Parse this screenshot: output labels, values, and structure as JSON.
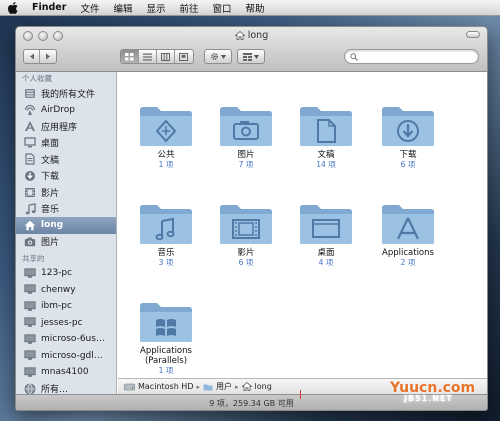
{
  "menubar": {
    "app_name": "Finder",
    "items": [
      "文件",
      "编辑",
      "显示",
      "前往",
      "窗口",
      "帮助"
    ]
  },
  "window": {
    "title": "long",
    "search_placeholder": "",
    "view_modes": [
      "icon",
      "list",
      "column",
      "cover-flow"
    ],
    "active_view": "icon"
  },
  "sidebar": {
    "favorites_heading": "个人收藏",
    "favorites": [
      {
        "label": "我的所有文件",
        "icon": "all-files-icon"
      },
      {
        "label": "AirDrop",
        "icon": "airdrop-icon"
      },
      {
        "label": "应用程序",
        "icon": "applications-icon"
      },
      {
        "label": "桌面",
        "icon": "desktop-icon"
      },
      {
        "label": "文稿",
        "icon": "documents-icon"
      },
      {
        "label": "下载",
        "icon": "downloads-icon"
      },
      {
        "label": "影片",
        "icon": "movies-icon"
      },
      {
        "label": "音乐",
        "icon": "music-icon"
      },
      {
        "label": "long",
        "icon": "home-icon",
        "selected": true
      },
      {
        "label": "图片",
        "icon": "pictures-icon"
      }
    ],
    "shared_heading": "共享的",
    "shared": [
      {
        "label": "123-pc"
      },
      {
        "label": "chenwy"
      },
      {
        "label": "ibm-pc"
      },
      {
        "label": "jesses-pc"
      },
      {
        "label": "microso-6us…"
      },
      {
        "label": "microso-gdl…"
      },
      {
        "label": "mnas4100"
      },
      {
        "label": "所有…"
      }
    ]
  },
  "folders": [
    {
      "name": "公共",
      "count": "1 项",
      "glyph": "public"
    },
    {
      "name": "图片",
      "count": "7 项",
      "glyph": "pictures"
    },
    {
      "name": "文稿",
      "count": "14 项",
      "glyph": "documents"
    },
    {
      "name": "下载",
      "count": "6 项",
      "glyph": "downloads"
    },
    {
      "name": "音乐",
      "count": "3 项",
      "glyph": "music"
    },
    {
      "name": "影片",
      "count": "6 项",
      "glyph": "movies"
    },
    {
      "name": "桌面",
      "count": "4 项",
      "glyph": "desktop"
    },
    {
      "name": "Applications",
      "count": "2 项",
      "glyph": "applications"
    },
    {
      "name": "Applications (Parallels)",
      "count": "1 项",
      "glyph": "windows"
    }
  ],
  "pathbar": [
    "Macintosh HD",
    "用户",
    "long"
  ],
  "status": "9 项，259.34 GB 可用",
  "watermark": {
    "text": "Yuucn.com",
    "sub": "JB51.NET"
  },
  "colors": {
    "accent": "#3f73c3",
    "folder": "#8fb8dc",
    "selection": "#7a91b2"
  }
}
